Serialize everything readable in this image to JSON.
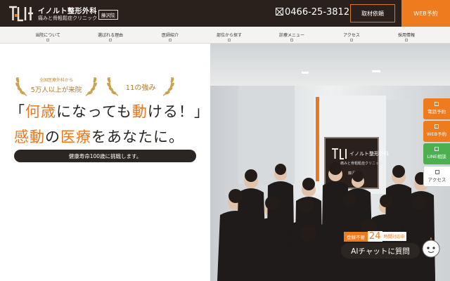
{
  "header": {
    "clinic_name": "イノルト整形外科",
    "clinic_sub": "痛みと骨粗鬆症クリニック",
    "branch": "藤沢院",
    "phone": "0466-25-3812",
    "interview_label": "取材依頼",
    "web_booking_label": "WEB予約"
  },
  "nav": {
    "items": [
      {
        "label": "当院について"
      },
      {
        "label": "選ばれる理由"
      },
      {
        "label": "医師紹介"
      },
      {
        "label": "部位から探す"
      },
      {
        "label": "診療メニュー"
      },
      {
        "label": "アクセス"
      },
      {
        "label": "採用情報"
      }
    ]
  },
  "hero": {
    "award1_small": "全国医療外科から",
    "award1_big": "5万人以上が来院",
    "award2": "11の強み",
    "headline1": {
      "open_bracket": "「",
      "part1": "何歳",
      "part2": "になっても",
      "part3": "動",
      "part4": "ける！」"
    },
    "headline2": {
      "part1": "感動",
      "part2": "の",
      "part3": "医療",
      "part4": "をあなたに。"
    },
    "tagline": "健康寿命100歳に挑戦します。"
  },
  "photo": {
    "sign_title": "イノルト整形外科",
    "sign_sub": "痛みと骨粗鬆症クリニック",
    "sign_branch": "藤沢院"
  },
  "side_tabs": [
    {
      "label": "電話予約"
    },
    {
      "label": "WEB予約"
    },
    {
      "label": "LINE相談"
    },
    {
      "label": "アクセス"
    }
  ],
  "chat": {
    "tag": "登録不要",
    "hours": "24",
    "hours_sub": "時間対応中",
    "main": "AIチャットに質問"
  },
  "colors": {
    "header_bg": "#2a211d",
    "accent": "#ef7b1f",
    "gold": "#b07a2a",
    "line_green": "#4caf50"
  }
}
